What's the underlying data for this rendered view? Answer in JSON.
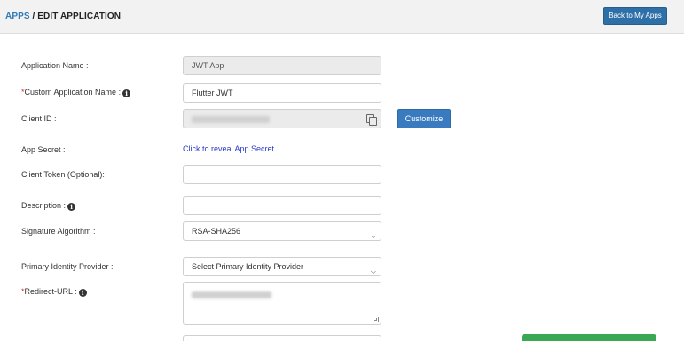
{
  "breadcrumb": {
    "apps": "APPS",
    "separator": " / ",
    "current": "EDIT APPLICATION"
  },
  "header": {
    "back_button": "Back to My Apps"
  },
  "form": {
    "app_name": {
      "label": "Application Name :",
      "value": "JWT App"
    },
    "custom_name": {
      "required_mark": "*",
      "label": "Custom Application Name :",
      "value": "Flutter JWT"
    },
    "client_id": {
      "label": "Client ID :",
      "customize_button": "Customize"
    },
    "app_secret": {
      "label": "App Secret :",
      "link": "Click to reveal App Secret"
    },
    "client_token": {
      "label": "Client Token (Optional):",
      "value": ""
    },
    "description": {
      "label": "Description :",
      "value": ""
    },
    "signature": {
      "label": "Signature Algorithm :",
      "selected": "RSA-SHA256"
    },
    "identity_provider": {
      "label": "Primary Identity Provider :",
      "selected": "Select Primary Identity Provider"
    },
    "redirect_url": {
      "required_mark": "*",
      "label": "Redirect-URL :"
    }
  },
  "colors": {
    "accent": "#337ab7",
    "primary_button": "#3a7bbf",
    "success": "#3aa853",
    "required": "#c9302c",
    "link": "#2a38c9"
  },
  "icons": [
    "info-icon",
    "copy-icon",
    "chevron-down-icon",
    "resize-handle-icon"
  ]
}
